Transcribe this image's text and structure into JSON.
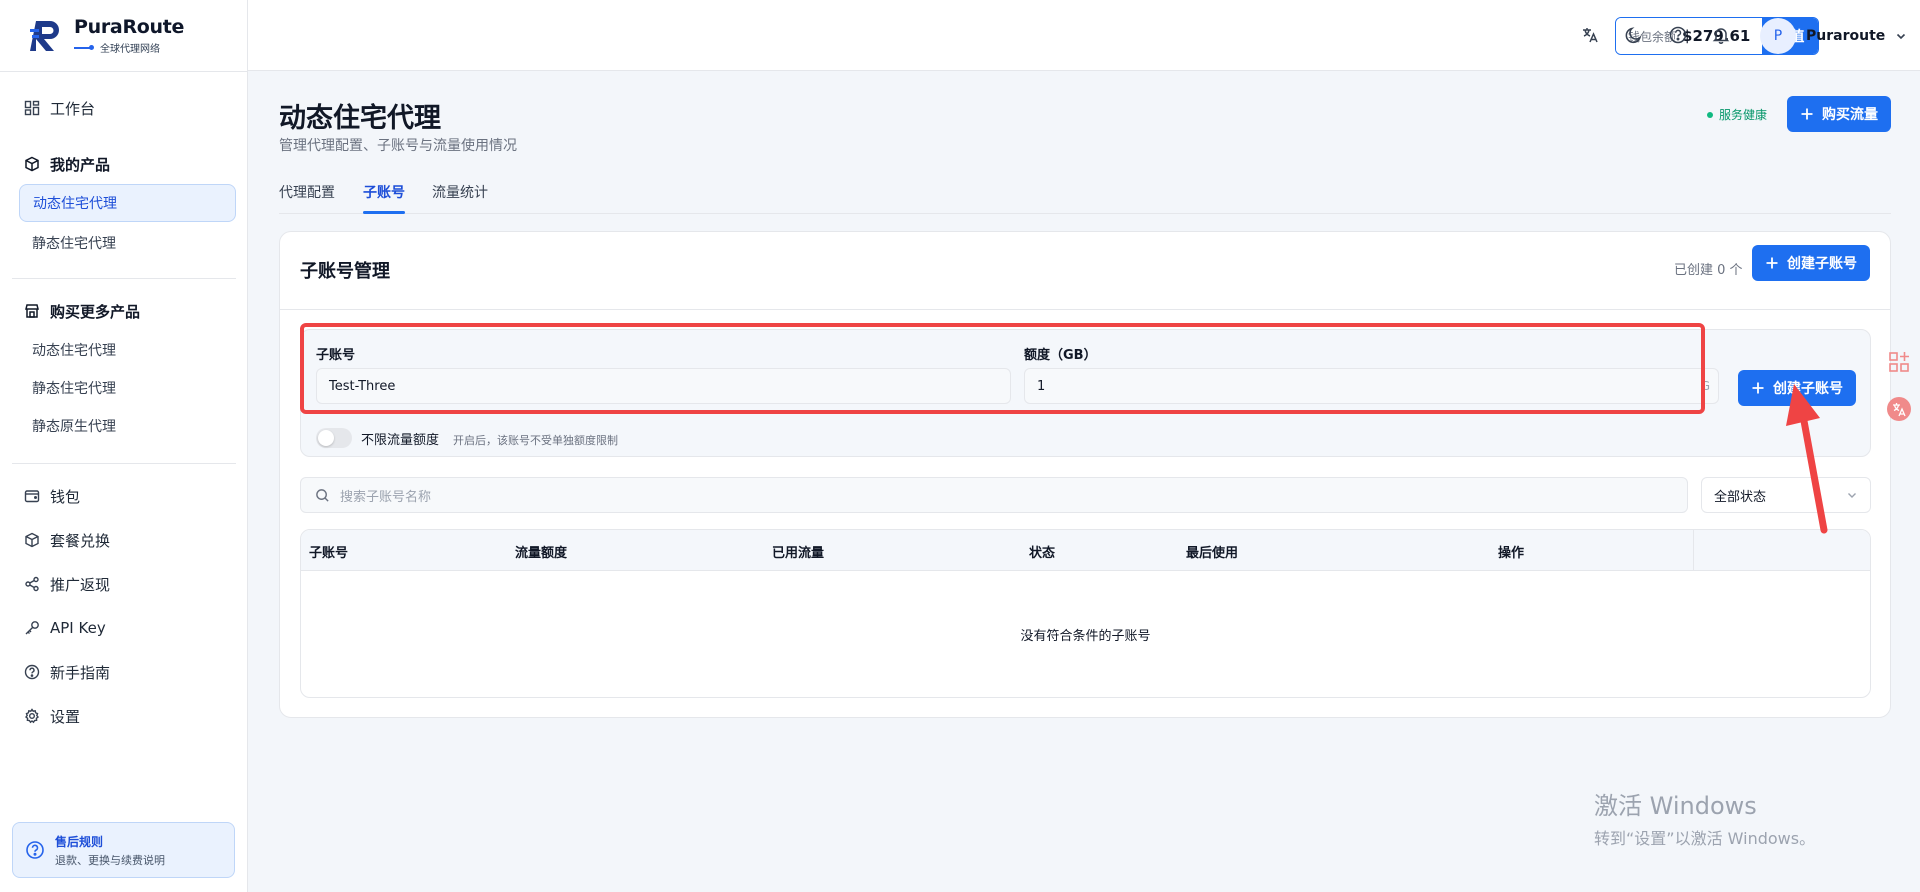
{
  "brand": {
    "name": "PuraRoute",
    "tagline": "全球代理网络"
  },
  "sidebar": {
    "workbench": "工作台",
    "my_products": "我的产品",
    "my_products_items": [
      "动态住宅代理",
      "静态住宅代理"
    ],
    "buy_more": "购买更多产品",
    "buy_more_items": [
      "动态住宅代理",
      "静态住宅代理",
      "静态原生代理"
    ],
    "bottom_items": [
      "钱包",
      "套餐兑换",
      "推广返现",
      "API Key",
      "新手指南",
      "设置"
    ],
    "help_title": "售后规则",
    "help_desc": "退款、更换与续费说明"
  },
  "topbar": {
    "wallet_label": "钱包余额",
    "wallet_amount": "$279.61",
    "recharge": "充值",
    "user_initial": "P",
    "user_name": "Puraroute"
  },
  "page": {
    "title": "动态住宅代理",
    "subtitle": "管理代理配置、子账号与流量使用情况",
    "health": "服务健康",
    "buy_traffic": "购买流量",
    "tabs": [
      "代理配置",
      "子账号",
      "流量统计"
    ],
    "active_tab": "子账号"
  },
  "card": {
    "title": "子账号管理",
    "count": "已创建 0 个",
    "create_button": "创建子账号",
    "form": {
      "account_label": "子账号",
      "account_value": "Test-Three",
      "quota_label": "额度（GB）",
      "quota_value": "1",
      "quota_unit": "G",
      "submit": "创建子账号",
      "unlimited_label": "不限流量额度",
      "unlimited_hint": "开启后，该账号不受单独额度限制",
      "unlimited_on": false
    },
    "search_placeholder": "搜索子账号名称",
    "status_filter": "全部状态",
    "table": {
      "columns": [
        "子账号",
        "流量额度",
        "已用流量",
        "状态",
        "最后使用",
        "操作"
      ],
      "rows": [],
      "empty_text": "没有符合条件的子账号"
    }
  },
  "watermark": {
    "line1": "激活 Windows",
    "line2": "转到“设置”以激活 Windows。"
  }
}
